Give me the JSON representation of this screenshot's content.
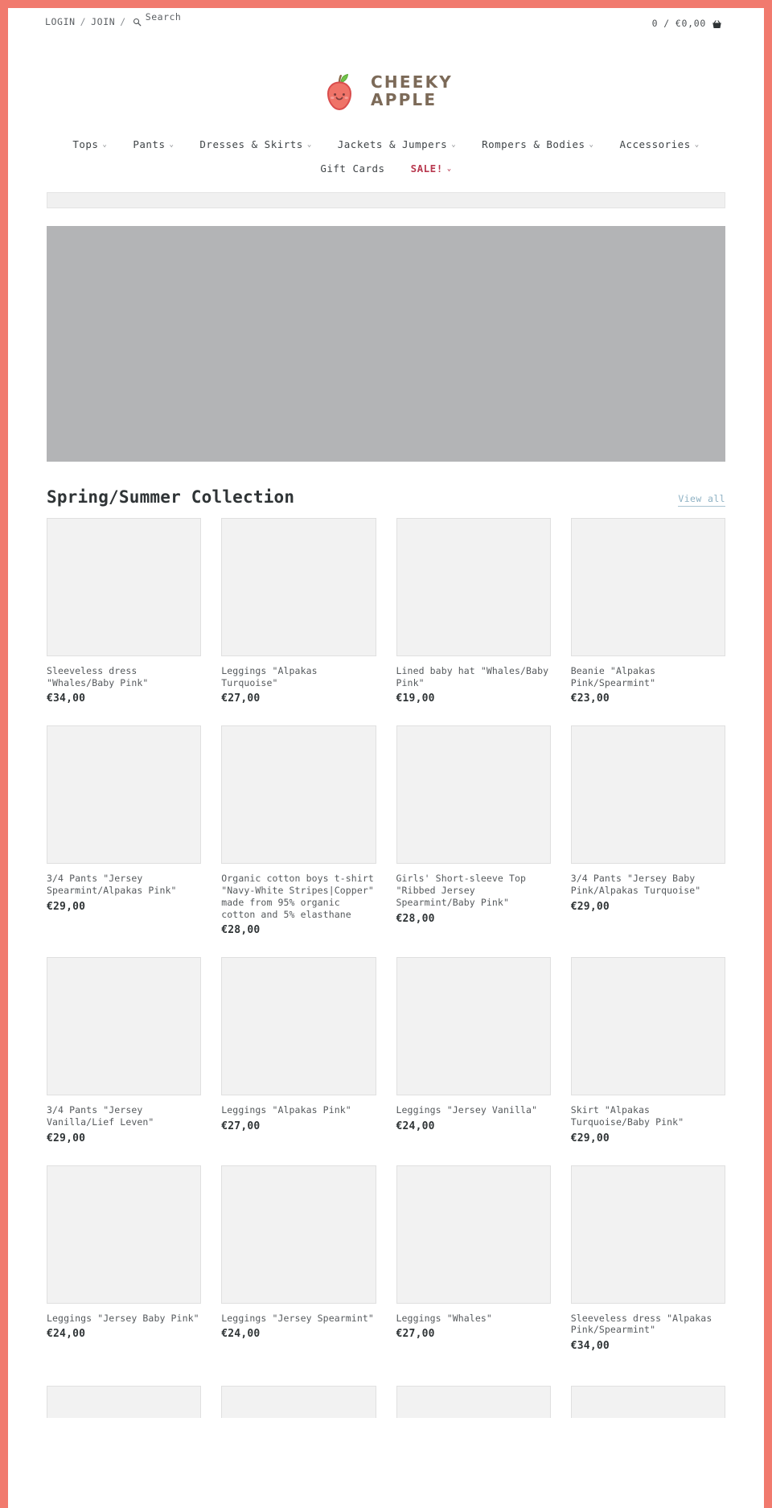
{
  "theme": {
    "page_border_color": "#f17a6e",
    "logo_brown": "#7c6a58",
    "apple_red": "#e8635e",
    "leaf_green": "#72c24a",
    "sale_color": "#b8394f",
    "link_color": "#8fb2c4",
    "hero_placeholder": "#b3b4b6",
    "card_placeholder": "#f2f2f2"
  },
  "utility": {
    "login_label": "LOGIN",
    "separator": "/",
    "join_label": "JOIN",
    "search_icon": "search-icon",
    "search_placeholder": "Search",
    "search_value": "",
    "cart_count": "0",
    "cart_divider": "/",
    "cart_total": "€0,00",
    "cart_icon": "shopping-basket-icon"
  },
  "logo": {
    "icon": "apple-logo-icon",
    "line1": "CHEEKY",
    "line2": "APPLE"
  },
  "nav": {
    "row1": [
      {
        "label": "Tops",
        "has_dropdown": true,
        "caret": "⌄"
      },
      {
        "label": "Pants",
        "has_dropdown": true,
        "caret": "⌄"
      },
      {
        "label": "Dresses & Skirts",
        "has_dropdown": true,
        "caret": "⌄"
      },
      {
        "label": "Jackets & Jumpers",
        "has_dropdown": true,
        "caret": "⌄"
      },
      {
        "label": "Rompers & Bodies",
        "has_dropdown": true,
        "caret": "⌄"
      },
      {
        "label": "Accessories",
        "has_dropdown": true,
        "caret": "⌄"
      }
    ],
    "row2": [
      {
        "label": "Gift Cards",
        "has_dropdown": false,
        "caret": ""
      },
      {
        "label": "SALE!",
        "has_dropdown": true,
        "caret": "⌄",
        "sale": true
      }
    ]
  },
  "collection": {
    "title": "Spring/Summer Collection",
    "view_all_label": "View all"
  },
  "products": [
    {
      "title": "Sleeveless dress \"Whales/Baby Pink\"",
      "price": "€34,00"
    },
    {
      "title": "Leggings \"Alpakas Turquoise\"",
      "price": "€27,00"
    },
    {
      "title": "Lined baby hat \"Whales/Baby Pink\"",
      "price": "€19,00"
    },
    {
      "title": "Beanie \"Alpakas Pink/Spearmint\"",
      "price": "€23,00"
    },
    {
      "title": "3/4 Pants \"Jersey Spearmint/Alpakas Pink\"",
      "price": "€29,00"
    },
    {
      "title": "Organic cotton boys t-shirt \"Navy-White Stripes|Copper\" made from 95% organic cotton and 5% elasthane",
      "price": "€28,00"
    },
    {
      "title": "Girls' Short-sleeve Top \"Ribbed Jersey Spearmint/Baby Pink\"",
      "price": "€28,00"
    },
    {
      "title": "3/4 Pants \"Jersey Baby Pink/Alpakas Turquoise\"",
      "price": "€29,00"
    },
    {
      "title": "3/4 Pants \"Jersey Vanilla/Lief Leven\"",
      "price": "€29,00"
    },
    {
      "title": "Leggings \"Alpakas Pink\"",
      "price": "€27,00"
    },
    {
      "title": "Leggings \"Jersey Vanilla\"",
      "price": "€24,00"
    },
    {
      "title": "Skirt \"Alpakas Turquoise/Baby Pink\"",
      "price": "€29,00"
    },
    {
      "title": "Leggings \"Jersey Baby Pink\"",
      "price": "€24,00"
    },
    {
      "title": "Leggings \"Jersey Spearmint\"",
      "price": "€24,00"
    },
    {
      "title": "Leggings \"Whales\"",
      "price": "€27,00"
    },
    {
      "title": "Sleeveless dress \"Alpakas Pink/Spearmint\"",
      "price": "€34,00"
    }
  ]
}
